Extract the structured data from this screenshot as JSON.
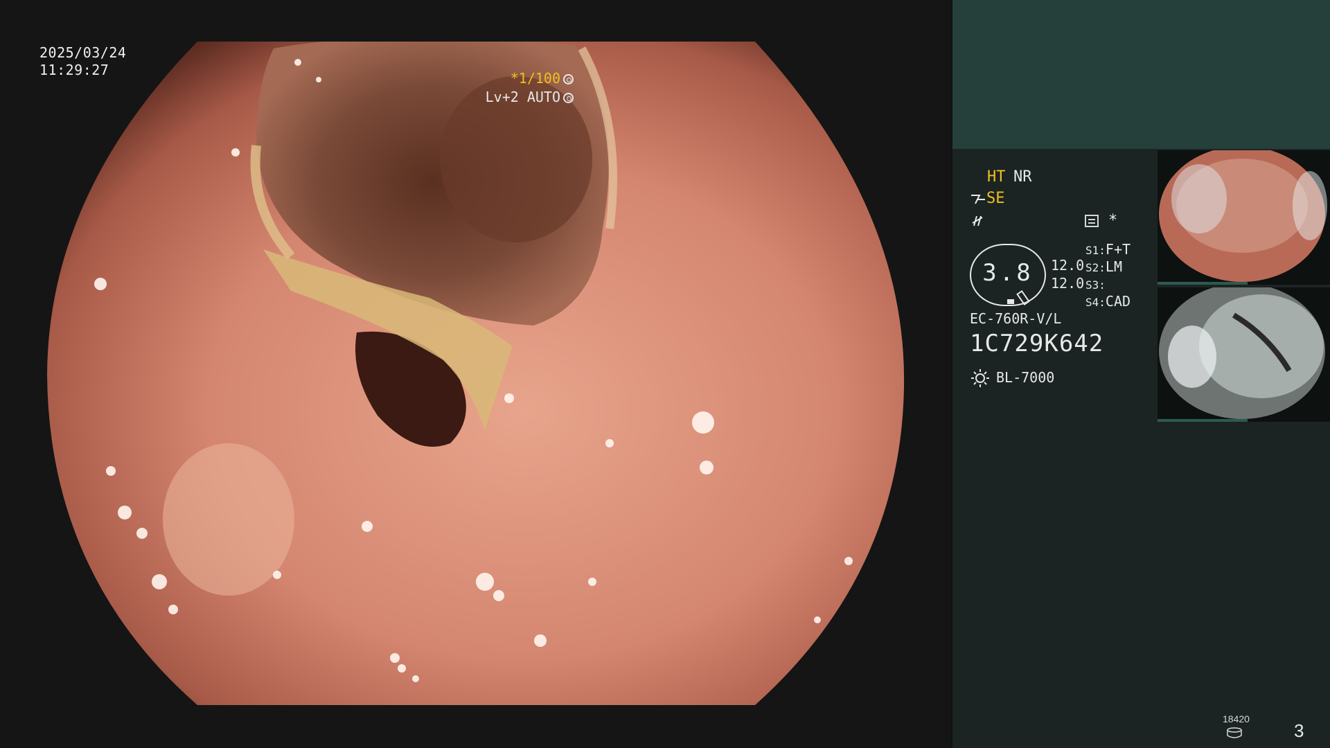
{
  "colors": {
    "accent_yellow": "#f0c020",
    "text": "#e8e8e8",
    "panel_top": "#25403a",
    "panel": "#1b2422",
    "tissue": "#d9876f"
  },
  "overlay": {
    "date": "2025/03/24",
    "time": "11:29:27",
    "shutter": "*1/100",
    "level": "Lv+2 AUTO"
  },
  "status": {
    "ht": "HT",
    "nr": "NR",
    "se": "SE",
    "settings_star": "*",
    "gauge_value": "3.8",
    "val1": "12.0",
    "val2": "12.0",
    "s1_label": "S1:",
    "s1_value": "F+T",
    "s2_label": "S2:",
    "s2_value": "LM",
    "s3_label": "S3:",
    "s3_value": "",
    "s4_label": "S4:",
    "s4_value": "CAD",
    "scope_model": "EC-760R-V/L",
    "serial": "1C729K642",
    "light_source": "BL-7000"
  },
  "icons": [
    "mode-se-icon",
    "function-icon",
    "settings-menu-icon",
    "shutter-mode-icon",
    "auto-iris-icon",
    "light-source-icon",
    "disk-icon"
  ],
  "thumbnails": [
    {
      "label": "1C729K642"
    },
    {
      "label": "1C729K642"
    }
  ],
  "footer": {
    "counter": "18420",
    "page": "3"
  }
}
